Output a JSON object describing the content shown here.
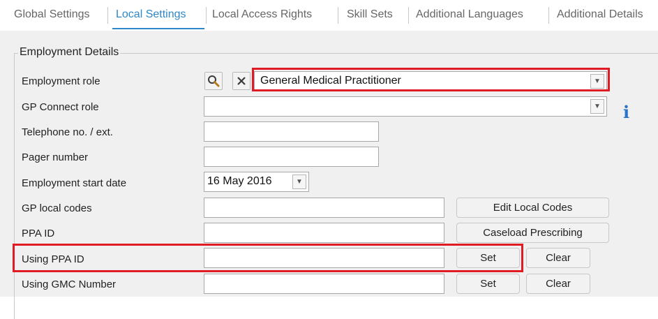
{
  "tabs": [
    {
      "label": "Global Settings"
    },
    {
      "label": "Local Settings",
      "active": true
    },
    {
      "label": "Local Access Rights"
    },
    {
      "label": "Skill Sets"
    },
    {
      "label": "Additional Languages"
    },
    {
      "label": "Additional Details"
    }
  ],
  "section": {
    "legend": "Employment Details"
  },
  "fields": {
    "employment_role": {
      "label": "Employment role",
      "value": "General Medical Practitioner"
    },
    "gp_connect_role": {
      "label": "GP Connect role",
      "value": ""
    },
    "telephone": {
      "label": "Telephone no. / ext.",
      "value": ""
    },
    "pager": {
      "label": "Pager number",
      "value": ""
    },
    "start_date": {
      "label": "Employment start date",
      "value": "16 May 2016"
    },
    "gp_local_codes": {
      "label": "GP local codes",
      "value": ""
    },
    "ppa_id": {
      "label": "PPA ID",
      "value": ""
    },
    "using_ppa_id": {
      "label": "Using PPA ID",
      "value": ""
    },
    "using_gmc": {
      "label": "Using GMC Number",
      "value": ""
    }
  },
  "buttons": {
    "edit_local_codes": "Edit Local Codes",
    "caseload_prescribing": "Caseload Prescribing",
    "set": "Set",
    "clear": "Clear"
  },
  "icons": {
    "search": "search-icon",
    "clear": "close-icon",
    "info": "info-icon",
    "dropdown": "chevron-down-icon"
  },
  "colors": {
    "highlight": "#e01b24",
    "active_tab": "#2f86c8",
    "info": "#2b73c8"
  }
}
